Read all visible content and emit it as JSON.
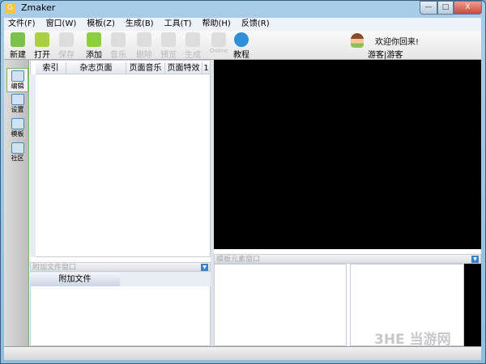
{
  "window": {
    "title": "Zmaker",
    "minimize": "—",
    "maximize": "□",
    "close": "X"
  },
  "menu": [
    "文件(F)",
    "窗口(W)",
    "模板(Z)",
    "生成(B)",
    "工具(T)",
    "帮助(H)",
    "反馈(R)"
  ],
  "toolbar": [
    {
      "label": "新建",
      "icon": "new-file-icon",
      "enabled": true,
      "color": "#7cc24a"
    },
    {
      "label": "打开",
      "icon": "open-folder-icon",
      "enabled": true,
      "color": "#a8d040"
    },
    {
      "label": "保存",
      "icon": "save-icon",
      "enabled": false,
      "color": "#ddd"
    },
    {
      "label": "添加",
      "icon": "add-icon",
      "enabled": true,
      "color": "#8ccf3c"
    },
    {
      "label": "音乐",
      "icon": "music-icon",
      "enabled": false,
      "color": "#ddd"
    },
    {
      "label": "删除",
      "icon": "delete-icon",
      "enabled": false,
      "color": "#ddd"
    },
    {
      "label": "预览",
      "icon": "preview-icon",
      "enabled": false,
      "color": "#ddd"
    },
    {
      "label": "生成",
      "icon": "generate-icon",
      "enabled": false,
      "color": "#ddd"
    },
    {
      "label": "Online",
      "icon": "online-icon",
      "enabled": false,
      "color": "#ddd"
    },
    {
      "label": "教程",
      "icon": "help-icon",
      "enabled": true,
      "color": "#2f8fd8"
    }
  ],
  "user": {
    "welcome": "欢迎你回来!",
    "name": "游客|游客",
    "icon": "user-avatar-icon"
  },
  "sidebar": [
    {
      "label": "编辑",
      "icon": "edit-icon"
    },
    {
      "label": "设置",
      "icon": "settings-icon"
    },
    {
      "label": "模板",
      "icon": "template-icon"
    },
    {
      "label": "社区",
      "icon": "community-icon"
    }
  ],
  "page_table": {
    "columns": [
      "索引",
      "杂志页面",
      "页面音乐",
      "页面特效",
      "1"
    ]
  },
  "attach_panel": {
    "title": "附加文件窗口",
    "tab": "附加文件"
  },
  "element_panel": {
    "title": "模板元素窗口"
  },
  "watermark": "3HE 当游网"
}
